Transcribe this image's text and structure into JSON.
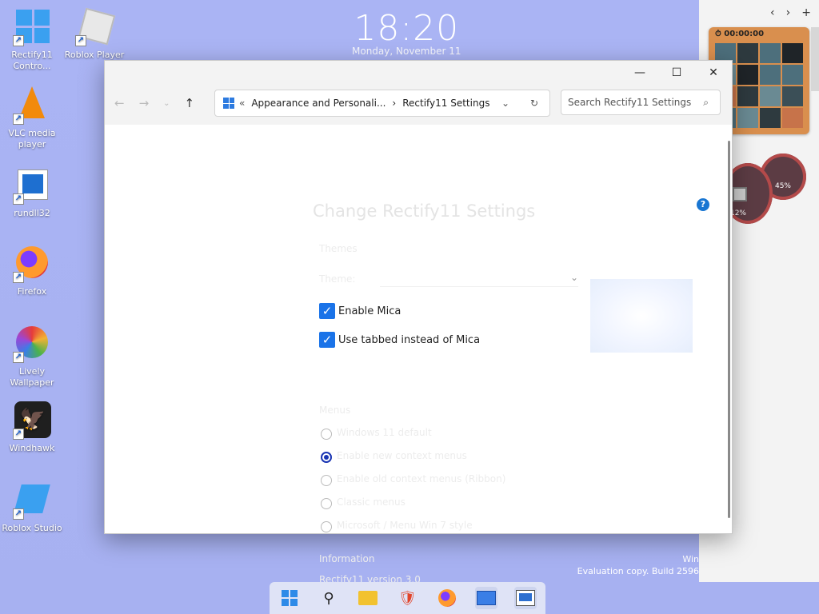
{
  "desktop": {
    "clock": {
      "time": "18:20",
      "date": "Monday, November 11"
    },
    "icons": [
      {
        "label": "Rectify11 Contro...",
        "icon": "control-panel-icon"
      },
      {
        "label": "Roblox Player",
        "icon": "roblox-icon"
      },
      {
        "label": "VLC media player",
        "icon": "vlc-icon"
      },
      {
        "label": "rundll32",
        "icon": "app-window-icon"
      },
      {
        "label": "Firefox",
        "icon": "firefox-icon"
      },
      {
        "label": "Lively Wallpaper",
        "icon": "lively-icon"
      },
      {
        "label": "Windhawk",
        "icon": "windhawk-icon"
      },
      {
        "label": "Roblox Studio",
        "icon": "roblox-studio-icon"
      }
    ],
    "watermark": {
      "line1": "Win",
      "line2": "Evaluation copy. Build 2596"
    }
  },
  "widgets": {
    "puzzle_timer": "00:00:00",
    "gauge1": "45%",
    "gauge2": "12%"
  },
  "window": {
    "breadcrumb": [
      "Appearance and Personali...",
      "Rectify11 Settings"
    ],
    "search_placeholder": "Search Rectify11 Settings",
    "heading": "Change Rectify11 Settings",
    "themes_label": "Themes",
    "theme_field": "Theme:",
    "checkbox1": "Enable Mica",
    "checkbox2": "Use tabbed instead of Mica",
    "menus_label": "Menus",
    "radios": [
      "Windows 11 default",
      "Enable new context menus",
      "Enable old context menus (Ribbon)",
      "Classic menus",
      "Microsoft / Menu Win 7 style"
    ],
    "info_label": "Information",
    "info_value": "Rectify11 version 3.0"
  },
  "taskbar": [
    "start-icon",
    "search-icon",
    "file-explorer-icon",
    "brave-icon",
    "firefox-icon",
    "control-panel-icon",
    "settings-window-icon"
  ]
}
